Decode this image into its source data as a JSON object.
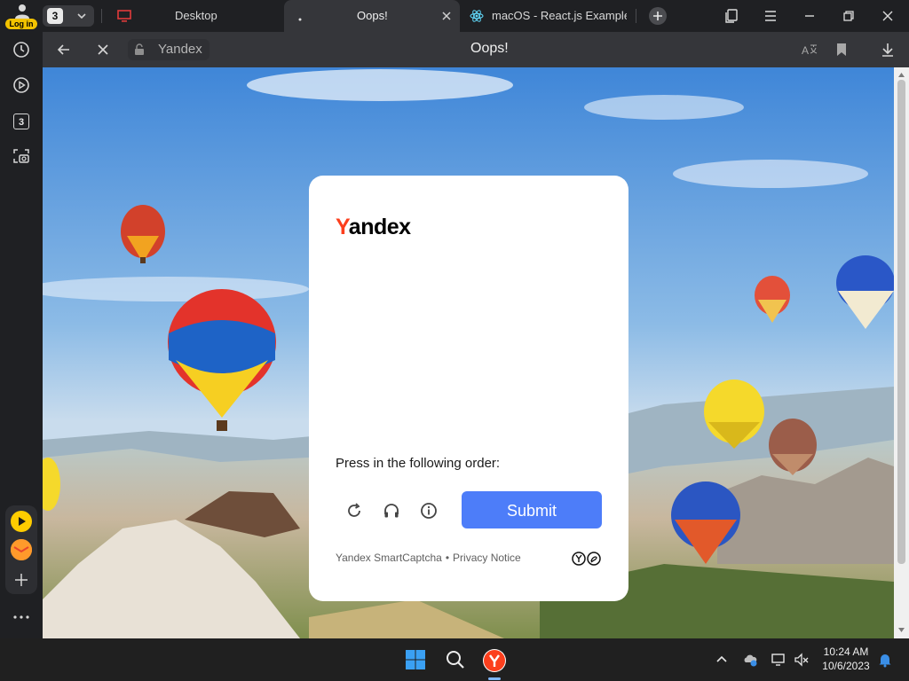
{
  "browser": {
    "login_label": "Log in",
    "tab_count": "3",
    "tabs": [
      {
        "title": "Desktop"
      },
      {
        "title": "Oops!"
      },
      {
        "title": "macOS - React.js Example"
      }
    ],
    "address": {
      "text": "Yandex"
    },
    "page_title": "Oops!"
  },
  "sidebar": {
    "tab_count_label": "3"
  },
  "background_photo": {
    "kind": "photo",
    "subject": "hot air balloons over a rocky valley landscape under a blue sky"
  },
  "captcha": {
    "logo_first_letter": "Y",
    "logo_rest": "andex",
    "instruction": "Press in the following order:",
    "submit_label": "Submit",
    "footer": {
      "brand": "Yandex SmartCaptcha",
      "separator": "•",
      "privacy": "Privacy Notice"
    },
    "icons": [
      "reload-icon",
      "audio-headphones-icon",
      "info-icon"
    ]
  },
  "taskbar": {
    "time": "10:24 AM",
    "date": "10/6/2023"
  },
  "colors": {
    "accent_submit": "#4d7df9",
    "yandex_red": "#fc3f1d",
    "login_badge": "#f2c200"
  }
}
